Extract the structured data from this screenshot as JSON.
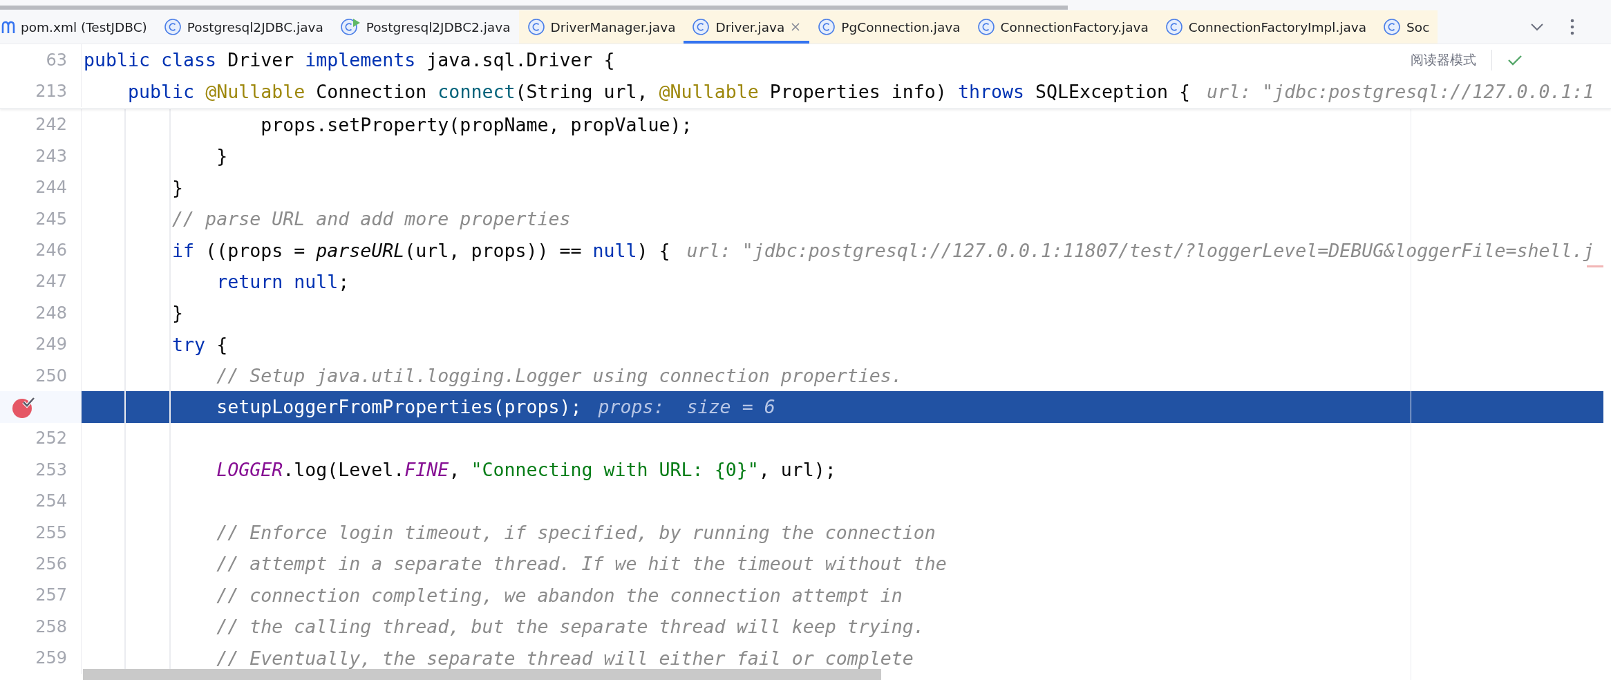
{
  "tabs": [
    {
      "label": "pom.xml (TestJDBC)",
      "kind": "maven",
      "selected": false,
      "library": false
    },
    {
      "label": "Postgresql2JDBC.java",
      "kind": "class",
      "selected": false,
      "library": false
    },
    {
      "label": "Postgresql2JDBC2.java",
      "kind": "class-run",
      "selected": false,
      "library": false
    },
    {
      "label": "DriverManager.java",
      "kind": "class",
      "selected": false,
      "library": true
    },
    {
      "label": "Driver.java",
      "kind": "class",
      "selected": true,
      "library": true
    },
    {
      "label": "PgConnection.java",
      "kind": "class",
      "selected": false,
      "library": true
    },
    {
      "label": "ConnectionFactory.java",
      "kind": "class",
      "selected": false,
      "library": true
    },
    {
      "label": "ConnectionFactoryImpl.java",
      "kind": "class",
      "selected": false,
      "library": true
    },
    {
      "label": "Soc",
      "kind": "class",
      "selected": false,
      "library": true
    }
  ],
  "reader_mode": "阅读器模式",
  "sticky_lines": [
    {
      "number": "63",
      "tokens": [
        {
          "kind": "kw",
          "s": "public class "
        },
        {
          "kind": "plain",
          "s": "Driver "
        },
        {
          "kind": "kw",
          "s": "implements "
        },
        {
          "kind": "plain",
          "s": "java.sql.Driver {"
        }
      ]
    },
    {
      "number": "213",
      "tokens": [
        {
          "kind": "kw",
          "s": "    public "
        },
        {
          "kind": "ann",
          "s": "@Nullable "
        },
        {
          "kind": "plain",
          "s": "Connection "
        },
        {
          "kind": "decl",
          "s": "connect"
        },
        {
          "kind": "plain",
          "s": "(String url, "
        },
        {
          "kind": "ann",
          "s": "@Nullable "
        },
        {
          "kind": "plain",
          "s": "Properties info) "
        },
        {
          "kind": "kw",
          "s": "throws "
        },
        {
          "kind": "plain",
          "s": "SQLException {"
        }
      ],
      "hint": "url: \"jdbc:postgresql://127.0.0.1:1"
    }
  ],
  "lines": [
    {
      "number": "242",
      "breakpoint": false,
      "current": false,
      "tokens": [
        {
          "kind": "plain",
          "s": "                props.setProperty(propName, propValue);"
        }
      ]
    },
    {
      "number": "243",
      "breakpoint": false,
      "current": false,
      "tokens": [
        {
          "kind": "plain",
          "s": "            }"
        }
      ]
    },
    {
      "number": "244",
      "breakpoint": false,
      "current": false,
      "tokens": [
        {
          "kind": "plain",
          "s": "        }"
        }
      ]
    },
    {
      "number": "245",
      "breakpoint": false,
      "current": false,
      "tokens": [
        {
          "kind": "comment",
          "s": "        // parse URL and add more properties"
        }
      ]
    },
    {
      "number": "246",
      "breakpoint": false,
      "current": false,
      "tokens": [
        {
          "kind": "kw",
          "s": "        if "
        },
        {
          "kind": "plain",
          "s": "((props = "
        },
        {
          "kind": "call",
          "s": "parseURL"
        },
        {
          "kind": "plain",
          "s": "(url, props)) == "
        },
        {
          "kind": "kw",
          "s": "null"
        },
        {
          "kind": "plain",
          "s": ") {"
        }
      ],
      "hint": "url: \"jdbc:postgresql://127.0.0.1:11807/test/?loggerLevel=DEBUG&loggerFile=shell.j"
    },
    {
      "number": "247",
      "breakpoint": false,
      "current": false,
      "tokens": [
        {
          "kind": "kw",
          "s": "            return null"
        },
        {
          "kind": "plain",
          "s": ";"
        }
      ]
    },
    {
      "number": "248",
      "breakpoint": false,
      "current": false,
      "tokens": [
        {
          "kind": "plain",
          "s": "        }"
        }
      ]
    },
    {
      "number": "249",
      "breakpoint": false,
      "current": false,
      "tokens": [
        {
          "kind": "kw",
          "s": "        try "
        },
        {
          "kind": "plain",
          "s": "{"
        }
      ]
    },
    {
      "number": "250",
      "breakpoint": false,
      "current": false,
      "tokens": [
        {
          "kind": "comment",
          "s": "            // Setup java.util.logging.Logger using connection properties."
        }
      ]
    },
    {
      "breakpoint": true,
      "current": true,
      "tokens": [
        {
          "kind": "plain",
          "s": "            setupLoggerFromProperties(props);"
        }
      ],
      "hint": "props:  size = 6"
    },
    {
      "number": "252",
      "breakpoint": false,
      "current": false
    },
    {
      "number": "253",
      "breakpoint": false,
      "current": false,
      "tokens": [
        {
          "kind": "static",
          "s": "            LOGGER"
        },
        {
          "kind": "plain",
          "s": ".log(Level."
        },
        {
          "kind": "static",
          "s": "FINE"
        },
        {
          "kind": "plain",
          "s": ", "
        },
        {
          "kind": "string",
          "s": "\"Connecting with URL: {0}\""
        },
        {
          "kind": "plain",
          "s": ", url);"
        }
      ]
    },
    {
      "number": "254",
      "breakpoint": false,
      "current": false
    },
    {
      "number": "255",
      "breakpoint": false,
      "current": false,
      "tokens": [
        {
          "kind": "comment",
          "s": "            // Enforce login timeout, if specified, by running the connection"
        }
      ]
    },
    {
      "number": "256",
      "breakpoint": false,
      "current": false,
      "tokens": [
        {
          "kind": "comment",
          "s": "            // attempt in a separate thread. If we hit the timeout without the"
        }
      ]
    },
    {
      "number": "257",
      "breakpoint": false,
      "current": false,
      "tokens": [
        {
          "kind": "comment",
          "s": "            // connection completing, we abandon the connection attempt in"
        }
      ]
    },
    {
      "number": "258",
      "breakpoint": false,
      "current": false,
      "tokens": [
        {
          "kind": "comment",
          "s": "            // the calling thread, but the separate thread will keep trying."
        }
      ]
    },
    {
      "number": "259",
      "breakpoint": false,
      "current": false,
      "tokens": [
        {
          "kind": "comment",
          "s": "            // Eventually, the separate thread will either fail or complete"
        }
      ]
    }
  ]
}
